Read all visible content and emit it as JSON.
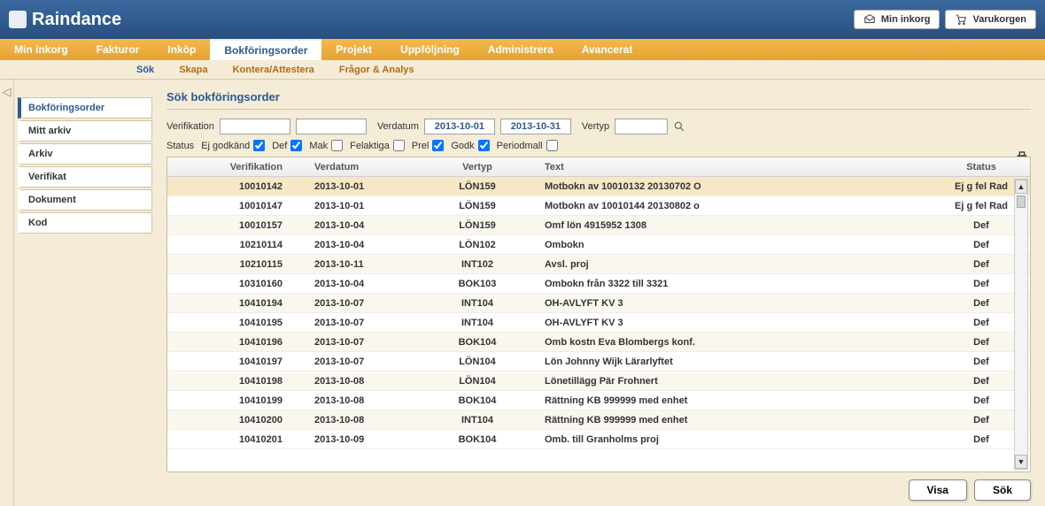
{
  "app_name": "Raindance",
  "top_buttons": {
    "inbox": "Min inkorg",
    "cart": "Varukorgen"
  },
  "main_nav": [
    "Min inkorg",
    "Fakturor",
    "Inköp",
    "Bokföringsorder",
    "Projekt",
    "Uppföljning",
    "Administrera",
    "Avancerat"
  ],
  "main_nav_active": 3,
  "sub_nav": [
    "Sök",
    "Skapa",
    "Kontera/Attestera",
    "Frågor & Analys"
  ],
  "sub_nav_active": 0,
  "side_nav": [
    "Bokföringsorder",
    "Mitt arkiv",
    "Arkiv",
    "Verifikat",
    "Dokument",
    "Kod"
  ],
  "side_nav_active": 0,
  "page_title": "Sök bokföringsorder",
  "filters": {
    "verifikation_label": "Verifikation",
    "verifikation_value1": "",
    "verifikation_value2": "",
    "verdatum_label": "Verdatum",
    "date_from": "2013-10-01",
    "date_to": "2013-10-31",
    "vertyp_label": "Vertyp",
    "vertyp_value": ""
  },
  "status": {
    "label": "Status",
    "ej_godkand": {
      "label": "Ej godkänd",
      "checked": true
    },
    "def": {
      "label": "Def",
      "checked": true
    },
    "mak": {
      "label": "Mak",
      "checked": false
    },
    "felaktiga": {
      "label": "Felaktiga",
      "checked": false
    },
    "prel": {
      "label": "Prel",
      "checked": true
    },
    "godk": {
      "label": "Godk",
      "checked": true
    },
    "periodmall": {
      "label": "Periodmall",
      "checked": false
    }
  },
  "columns": {
    "ver": "Verifikation",
    "date": "Verdatum",
    "typ": "Vertyp",
    "text": "Text",
    "status": "Status"
  },
  "rows": [
    {
      "ver": "10010142",
      "date": "2013-10-01",
      "typ": "LÖN159",
      "text": "Motbokn av 10010132 20130702 O",
      "status": "Ej g fel Rad",
      "sel": true
    },
    {
      "ver": "10010147",
      "date": "2013-10-01",
      "typ": "LÖN159",
      "text": "Motbokn av 10010144 20130802 o",
      "status": "Ej g fel Rad"
    },
    {
      "ver": "10010157",
      "date": "2013-10-04",
      "typ": "LÖN159",
      "text": "Omf lön 4915952 1308",
      "status": "Def"
    },
    {
      "ver": "10210114",
      "date": "2013-10-04",
      "typ": "LÖN102",
      "text": "Ombokn",
      "status": "Def"
    },
    {
      "ver": "10210115",
      "date": "2013-10-11",
      "typ": "INT102",
      "text": "Avsl. proj",
      "status": "Def"
    },
    {
      "ver": "10310160",
      "date": "2013-10-04",
      "typ": "BOK103",
      "text": "Ombokn från 3322 till 3321",
      "status": "Def"
    },
    {
      "ver": "10410194",
      "date": "2013-10-07",
      "typ": "INT104",
      "text": "OH-AVLYFT KV 3",
      "status": "Def"
    },
    {
      "ver": "10410195",
      "date": "2013-10-07",
      "typ": "INT104",
      "text": "OH-AVLYFT KV 3",
      "status": "Def"
    },
    {
      "ver": "10410196",
      "date": "2013-10-07",
      "typ": "BOK104",
      "text": "Omb kostn Eva Blombergs konf.",
      "status": "Def"
    },
    {
      "ver": "10410197",
      "date": "2013-10-07",
      "typ": "LÖN104",
      "text": "Lön Johnny Wijk Lärarlyftet",
      "status": "Def"
    },
    {
      "ver": "10410198",
      "date": "2013-10-08",
      "typ": "LÖN104",
      "text": "Lönetillägg Pär Frohnert",
      "status": "Def"
    },
    {
      "ver": "10410199",
      "date": "2013-10-08",
      "typ": "BOK104",
      "text": "Rättning KB 999999 med enhet",
      "status": "Def"
    },
    {
      "ver": "10410200",
      "date": "2013-10-08",
      "typ": "INT104",
      "text": "Rättning KB 999999 med enhet",
      "status": "Def"
    },
    {
      "ver": "10410201",
      "date": "2013-10-09",
      "typ": "BOK104",
      "text": "Omb. till Granholms proj",
      "status": "Def"
    }
  ],
  "buttons": {
    "visa": "Visa",
    "sok": "Sök"
  }
}
